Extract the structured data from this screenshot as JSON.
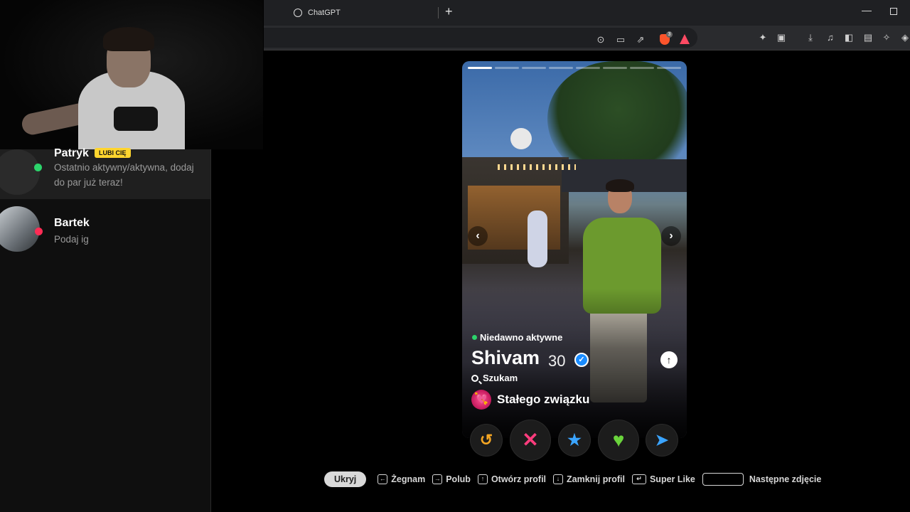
{
  "browser": {
    "tab_title": "ChatGPT",
    "new_tab": "+",
    "minimize": "—"
  },
  "sidebar": {
    "matches": [
      {
        "name": "Patryk",
        "badge": "LUBI CIĘ",
        "message": "Ostatnio aktywny/aktywna, dodaj do par już teraz!",
        "status_color": "#2cd46b"
      },
      {
        "name": "Bartek",
        "message": "Podaj ig",
        "status_color": "#ff2c55"
      }
    ]
  },
  "profile": {
    "status": "Niedawno aktywne",
    "name": "Shivam",
    "age": "30",
    "verified_mark": "✓",
    "looking_label": "Szukam",
    "goal": "Stałego związku",
    "goal_icon": "💘",
    "expand_icon": "↑",
    "prev_icon": "‹",
    "next_icon": "›",
    "photo_count": 8,
    "active_photo_index": 0
  },
  "actions": {
    "rewind": "↺",
    "nope": "✕",
    "super_like": "★",
    "like": "♥",
    "boost": "➤"
  },
  "shortcuts": {
    "hide": "Ukryj",
    "nope": "Żegnam",
    "like": "Polub",
    "open_profile": "Otwórz profil",
    "close_profile": "Zamknij profil",
    "super_like": "Super Like",
    "next_photo": "Następne zdjęcie"
  },
  "colors": {
    "badge": "#ffd52e",
    "online": "#2cd46b",
    "like_green": "#6ad43c",
    "nope_pink": "#ff3c7d",
    "super_blue": "#3aa4ff",
    "rewind_gold": "#f5a623"
  }
}
